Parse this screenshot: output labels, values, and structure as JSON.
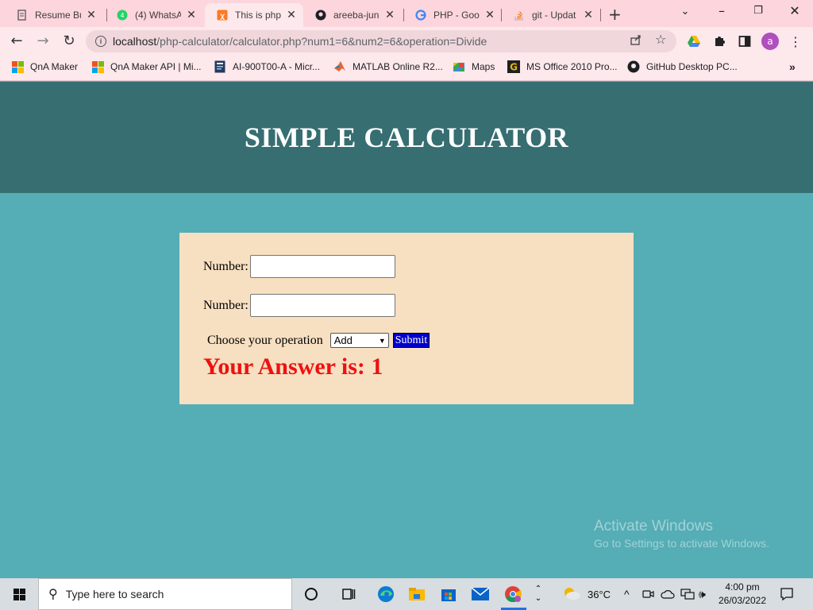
{
  "browser": {
    "tabs": [
      {
        "title": "Resume Bu",
        "icon": "document-icon"
      },
      {
        "title": "(4) WhatsAp",
        "icon": "whatsapp-icon"
      },
      {
        "title": "This is php",
        "icon": "xampp-icon"
      },
      {
        "title": "areeba-jun",
        "icon": "github-icon"
      },
      {
        "title": "PHP - Goo",
        "icon": "google-icon"
      },
      {
        "title": "git - Updat",
        "icon": "stackoverflow-icon"
      }
    ],
    "active_tab_index": 2,
    "url_host": "localhost",
    "url_path": "/php-calculator/calculator.php?num1=6&num2=6&operation=Divide",
    "profile_initial": "a",
    "bookmarks": [
      {
        "label": "QnA Maker",
        "icon": "microsoft-icon"
      },
      {
        "label": "QnA Maker API | Mi...",
        "icon": "microsoft-icon"
      },
      {
        "label": "AI-900T00-A - Micr...",
        "icon": "course-icon"
      },
      {
        "label": "MATLAB Online R2...",
        "icon": "matlab-icon"
      },
      {
        "label": "Maps",
        "icon": "maps-icon"
      },
      {
        "label": "MS Office 2010 Pro...",
        "icon": "g-icon"
      },
      {
        "label": "GitHub Desktop PC...",
        "icon": "github-icon"
      }
    ],
    "more_bookmarks": "»"
  },
  "page": {
    "heading": "SIMPLE CALCULATOR",
    "number1_label": "Number:",
    "number1_value": "",
    "number2_label": "Number:",
    "number2_value": "",
    "operation_label": "Choose your operation",
    "operation_selected": "Add",
    "submit_label": "Submit",
    "answer_text": "Your Answer is: 1"
  },
  "watermark": {
    "line1": "Activate Windows",
    "line2": "Go to Settings to activate Windows."
  },
  "taskbar": {
    "search_placeholder": "Type here to search",
    "temperature": "36°C",
    "time": "4:00 pm",
    "date": "26/03/2022"
  },
  "colors": {
    "page_background": "#55adb5",
    "header_background": "#366e71",
    "card_background": "#f7dfc1",
    "answer_color": "#ee1111",
    "submit_background": "#0000cd",
    "tabstrip_background": "#fcd5dd"
  }
}
